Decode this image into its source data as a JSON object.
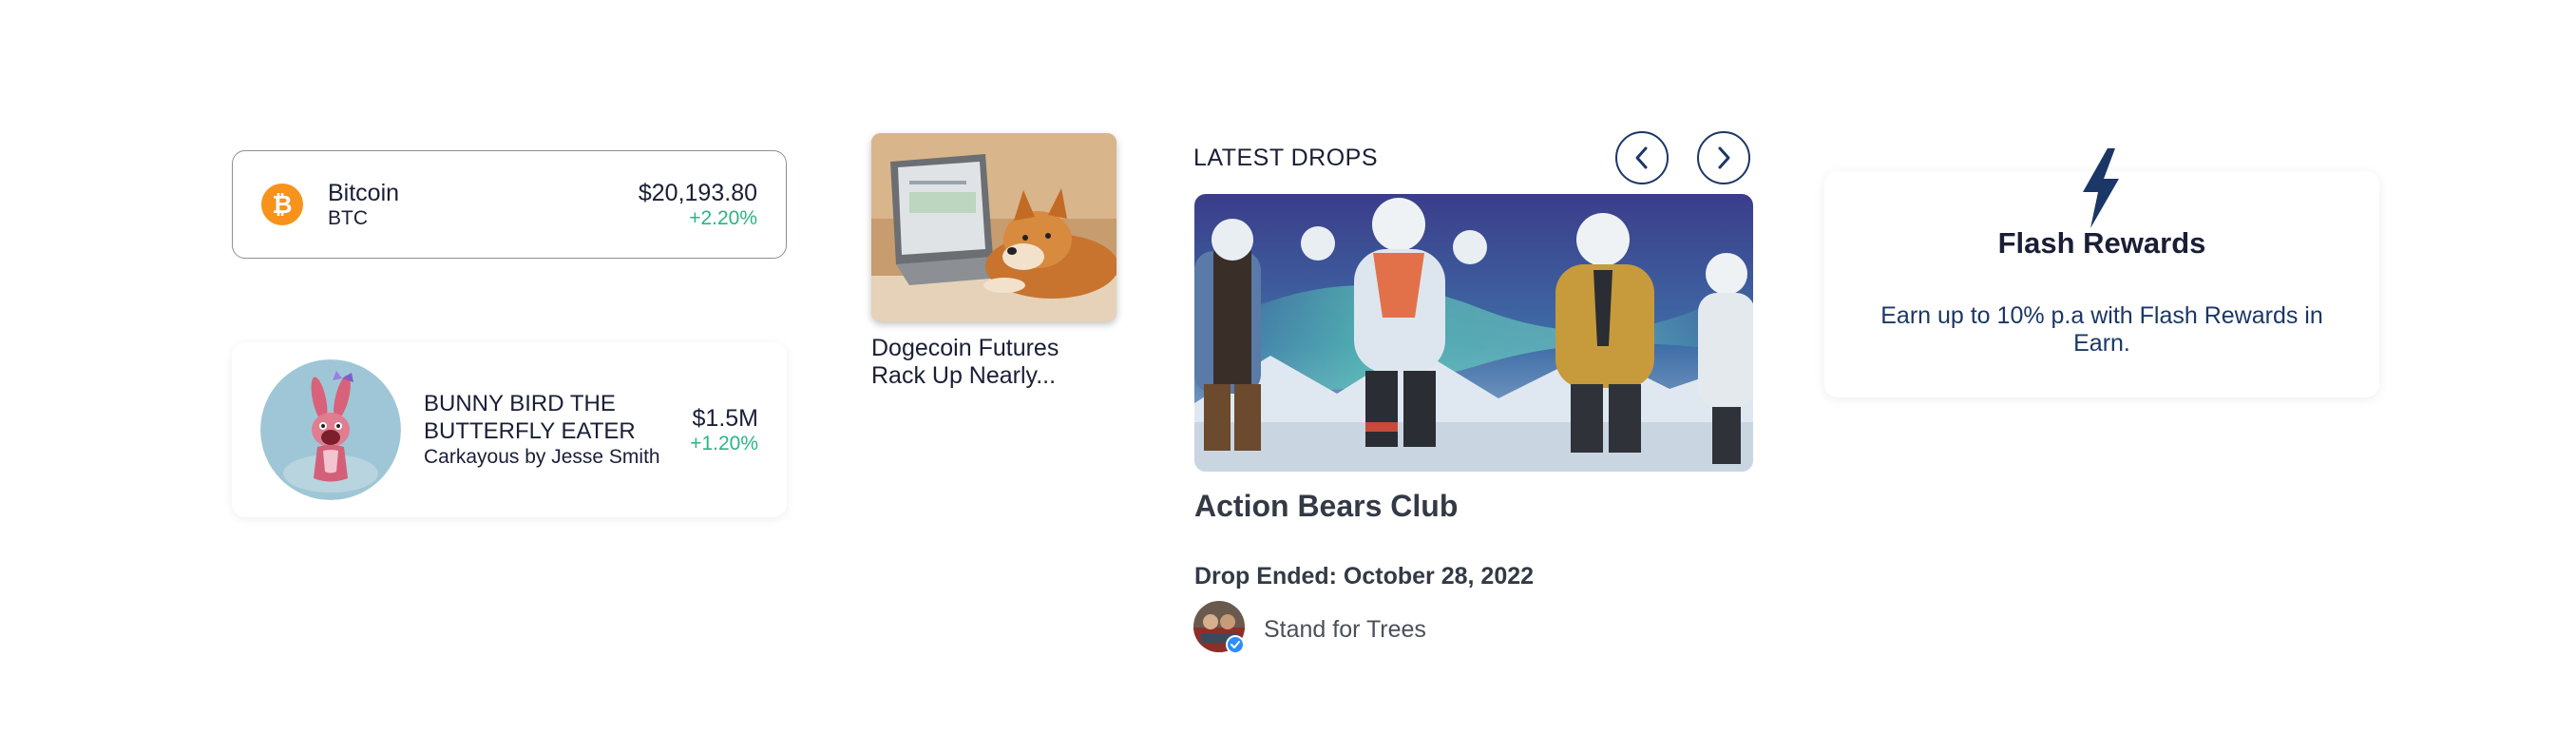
{
  "coin": {
    "name": "Bitcoin",
    "ticker": "BTC",
    "price": "$20,193.80",
    "change": "+2.20%",
    "icon": "bitcoin-icon",
    "brand_color": "#f7931a",
    "change_color": "#2bb584"
  },
  "nft": {
    "title": "BUNNY BIRD THE BUTTERFLY EATER",
    "artist": "Carkayous by Jesse Smith",
    "price": "$1.5M",
    "change": "+1.20%"
  },
  "news": {
    "title": "Dogecoin Futures Rack Up Nearly..."
  },
  "drops": {
    "heading": "LATEST DROPS",
    "prev_icon": "chevron-left-icon",
    "next_icon": "chevron-right-icon",
    "title": "Action Bears Club",
    "date": "Drop Ended: October 28, 2022",
    "creator": "Stand for Trees",
    "accent": "#1b3766"
  },
  "flash": {
    "title": "Flash Rewards",
    "description": "Earn up to 10% p.a with Flash Rewards in Earn.",
    "icon": "lightning-icon",
    "accent": "#1b3766"
  }
}
